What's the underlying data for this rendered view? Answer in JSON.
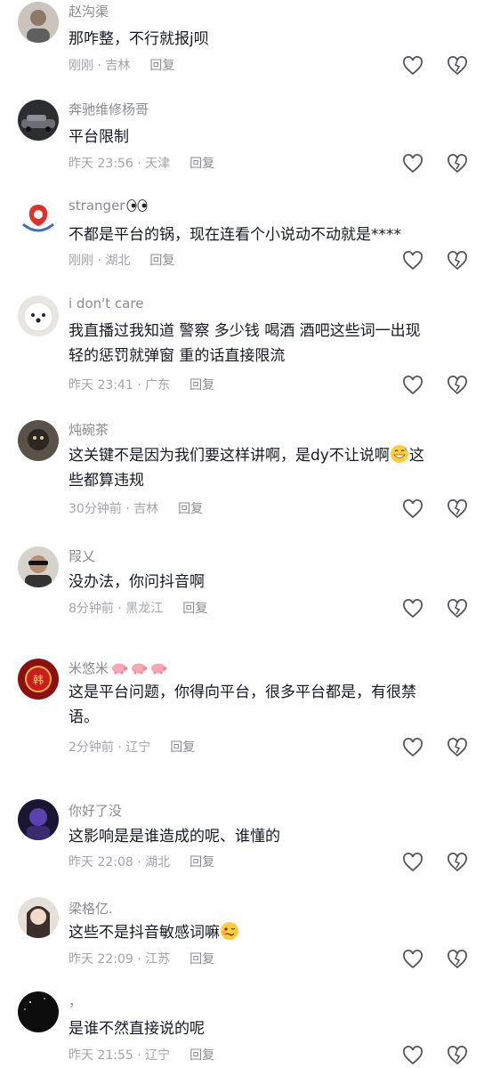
{
  "comments": [
    {
      "username": "赵沟渠",
      "text": "那咋整，不行就报j呗",
      "time": "刚刚 · 吉林",
      "reply": "回复"
    },
    {
      "username": "奔驰维修杨哥",
      "text": "平台限制",
      "time": "昨天 23:56 · 天津",
      "reply": "回复"
    },
    {
      "username": "stranger",
      "username_emoji": "eyes-emoji",
      "text": "不都是平台的锅，现在连看个小说动不动就是****",
      "time": "刚刚 · 湖北",
      "reply": "回复"
    },
    {
      "username": "i don't care",
      "text_lines": [
        "我直播过我知道 警察 多少钱 喝酒 酒吧这些词一出现",
        "轻的惩罚就弹窗 重的话直接限流"
      ],
      "time": "昨天 23:41 · 广东",
      "reply": "回复"
    },
    {
      "username": "炖碗茶",
      "text_lines": [
        "这关键不是因为我们要这样讲啊，是dy不让说啊",
        "些都算违规"
      ],
      "line1_tail": "这",
      "line1_emoji": "grin-sweat-emoji",
      "time": "30分钟前 · 吉林",
      "reply": "回复"
    },
    {
      "username": "叚乂",
      "text": "没办法，你问抖音啊",
      "time": "8分钟前 · 黑龙江",
      "reply": "回复"
    },
    {
      "username": "米悠米",
      "username_emoji": "pig-emoji",
      "text_lines": [
        "这是平台问题，你得向平台，很多平台都是，有很禁",
        "语。"
      ],
      "time": "2分钟前 · 辽宁",
      "reply": "回复"
    },
    {
      "username": "你好了没",
      "text": "这影响是是谁造成的呢、谁懂的",
      "time": "昨天 22:08 · 湖北",
      "reply": "回复"
    },
    {
      "username": "梁格亿.",
      "text": "这些不是抖音敏感词嘛",
      "text_emoji": "woozy-emoji",
      "time": "昨天 22:09 · 江苏",
      "reply": "回复"
    },
    {
      "username": "，",
      "text": "是谁不然直接说的呢",
      "time": "昨天 21:55 · 辽宁",
      "reply": "回复"
    }
  ]
}
